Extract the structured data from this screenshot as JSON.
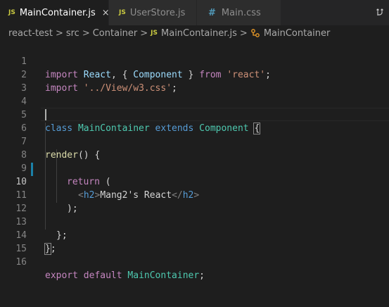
{
  "tabs": [
    {
      "icon": "JS",
      "label": "MainContainer.js",
      "active": true,
      "close": "×"
    },
    {
      "icon": "JS",
      "label": "UserStore.js",
      "active": false
    },
    {
      "icon": "#",
      "label": "Main.css",
      "active": false
    }
  ],
  "breadcrumb": {
    "items": [
      "react-test",
      "src",
      "Container",
      "MainContainer.js",
      "MainContainer"
    ],
    "separator": ">",
    "js_icon": "JS"
  },
  "editor": {
    "line_numbers": [
      "1",
      "2",
      "3",
      "4",
      "5",
      "6",
      "7",
      "8",
      "9",
      "10",
      "11",
      "12",
      "13",
      "14",
      "15",
      "16"
    ],
    "tokens": {
      "l1": [
        "import",
        " ",
        "React",
        ", { ",
        "Component",
        " } ",
        "from",
        " ",
        "'react'",
        ";"
      ],
      "l2": [
        "import",
        " ",
        "'../View/w3.css'",
        ";"
      ],
      "l5": [
        "class",
        " ",
        "MainContainer",
        " ",
        "extends",
        " ",
        "Component",
        " ",
        "{"
      ],
      "l7": [
        "render",
        "() {"
      ],
      "l9": [
        "return",
        " ("
      ],
      "l10": [
        "<",
        "h2",
        ">",
        "Mang2's React",
        "</",
        "h2",
        ">"
      ],
      "l11": [
        ");"
      ],
      "l13": [
        "};"
      ],
      "l14": [
        "}",
        ";"
      ],
      "l16": [
        "export",
        " ",
        "default",
        " ",
        "MainContainer",
        ";"
      ]
    }
  },
  "colors": {
    "background": "#1e1e1e",
    "keyword": "#569cd6",
    "control_keyword": "#c586c0",
    "class_name": "#4ec9b0",
    "variable": "#9cdcfe",
    "string": "#ce9178",
    "function": "#dcdcaa",
    "modified_gutter": "#1b81a8"
  }
}
